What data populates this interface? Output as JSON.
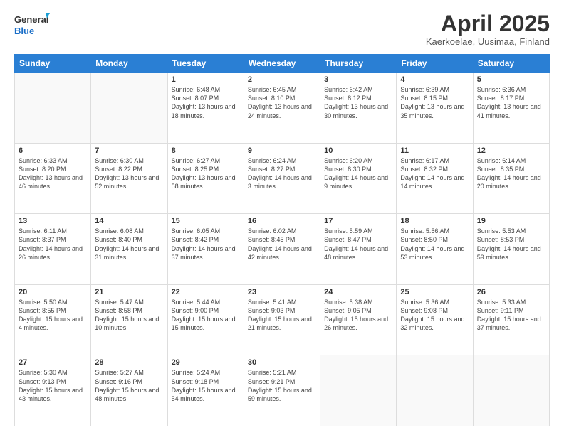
{
  "logo": {
    "line1": "General",
    "line2": "Blue"
  },
  "title": "April 2025",
  "subtitle": "Kaerkoelae, Uusimaa, Finland",
  "days_of_week": [
    "Sunday",
    "Monday",
    "Tuesday",
    "Wednesday",
    "Thursday",
    "Friday",
    "Saturday"
  ],
  "weeks": [
    [
      {
        "num": "",
        "info": ""
      },
      {
        "num": "",
        "info": ""
      },
      {
        "num": "1",
        "info": "Sunrise: 6:48 AM\nSunset: 8:07 PM\nDaylight: 13 hours and 18 minutes."
      },
      {
        "num": "2",
        "info": "Sunrise: 6:45 AM\nSunset: 8:10 PM\nDaylight: 13 hours and 24 minutes."
      },
      {
        "num": "3",
        "info": "Sunrise: 6:42 AM\nSunset: 8:12 PM\nDaylight: 13 hours and 30 minutes."
      },
      {
        "num": "4",
        "info": "Sunrise: 6:39 AM\nSunset: 8:15 PM\nDaylight: 13 hours and 35 minutes."
      },
      {
        "num": "5",
        "info": "Sunrise: 6:36 AM\nSunset: 8:17 PM\nDaylight: 13 hours and 41 minutes."
      }
    ],
    [
      {
        "num": "6",
        "info": "Sunrise: 6:33 AM\nSunset: 8:20 PM\nDaylight: 13 hours and 46 minutes."
      },
      {
        "num": "7",
        "info": "Sunrise: 6:30 AM\nSunset: 8:22 PM\nDaylight: 13 hours and 52 minutes."
      },
      {
        "num": "8",
        "info": "Sunrise: 6:27 AM\nSunset: 8:25 PM\nDaylight: 13 hours and 58 minutes."
      },
      {
        "num": "9",
        "info": "Sunrise: 6:24 AM\nSunset: 8:27 PM\nDaylight: 14 hours and 3 minutes."
      },
      {
        "num": "10",
        "info": "Sunrise: 6:20 AM\nSunset: 8:30 PM\nDaylight: 14 hours and 9 minutes."
      },
      {
        "num": "11",
        "info": "Sunrise: 6:17 AM\nSunset: 8:32 PM\nDaylight: 14 hours and 14 minutes."
      },
      {
        "num": "12",
        "info": "Sunrise: 6:14 AM\nSunset: 8:35 PM\nDaylight: 14 hours and 20 minutes."
      }
    ],
    [
      {
        "num": "13",
        "info": "Sunrise: 6:11 AM\nSunset: 8:37 PM\nDaylight: 14 hours and 26 minutes."
      },
      {
        "num": "14",
        "info": "Sunrise: 6:08 AM\nSunset: 8:40 PM\nDaylight: 14 hours and 31 minutes."
      },
      {
        "num": "15",
        "info": "Sunrise: 6:05 AM\nSunset: 8:42 PM\nDaylight: 14 hours and 37 minutes."
      },
      {
        "num": "16",
        "info": "Sunrise: 6:02 AM\nSunset: 8:45 PM\nDaylight: 14 hours and 42 minutes."
      },
      {
        "num": "17",
        "info": "Sunrise: 5:59 AM\nSunset: 8:47 PM\nDaylight: 14 hours and 48 minutes."
      },
      {
        "num": "18",
        "info": "Sunrise: 5:56 AM\nSunset: 8:50 PM\nDaylight: 14 hours and 53 minutes."
      },
      {
        "num": "19",
        "info": "Sunrise: 5:53 AM\nSunset: 8:53 PM\nDaylight: 14 hours and 59 minutes."
      }
    ],
    [
      {
        "num": "20",
        "info": "Sunrise: 5:50 AM\nSunset: 8:55 PM\nDaylight: 15 hours and 4 minutes."
      },
      {
        "num": "21",
        "info": "Sunrise: 5:47 AM\nSunset: 8:58 PM\nDaylight: 15 hours and 10 minutes."
      },
      {
        "num": "22",
        "info": "Sunrise: 5:44 AM\nSunset: 9:00 PM\nDaylight: 15 hours and 15 minutes."
      },
      {
        "num": "23",
        "info": "Sunrise: 5:41 AM\nSunset: 9:03 PM\nDaylight: 15 hours and 21 minutes."
      },
      {
        "num": "24",
        "info": "Sunrise: 5:38 AM\nSunset: 9:05 PM\nDaylight: 15 hours and 26 minutes."
      },
      {
        "num": "25",
        "info": "Sunrise: 5:36 AM\nSunset: 9:08 PM\nDaylight: 15 hours and 32 minutes."
      },
      {
        "num": "26",
        "info": "Sunrise: 5:33 AM\nSunset: 9:11 PM\nDaylight: 15 hours and 37 minutes."
      }
    ],
    [
      {
        "num": "27",
        "info": "Sunrise: 5:30 AM\nSunset: 9:13 PM\nDaylight: 15 hours and 43 minutes."
      },
      {
        "num": "28",
        "info": "Sunrise: 5:27 AM\nSunset: 9:16 PM\nDaylight: 15 hours and 48 minutes."
      },
      {
        "num": "29",
        "info": "Sunrise: 5:24 AM\nSunset: 9:18 PM\nDaylight: 15 hours and 54 minutes."
      },
      {
        "num": "30",
        "info": "Sunrise: 5:21 AM\nSunset: 9:21 PM\nDaylight: 15 hours and 59 minutes."
      },
      {
        "num": "",
        "info": ""
      },
      {
        "num": "",
        "info": ""
      },
      {
        "num": "",
        "info": ""
      }
    ]
  ]
}
